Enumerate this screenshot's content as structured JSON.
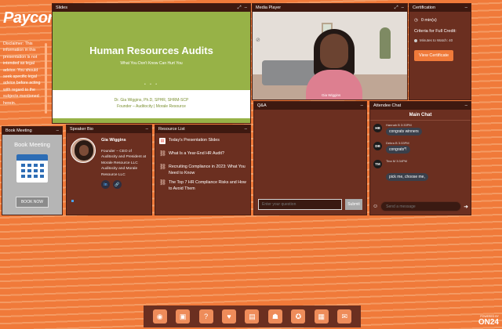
{
  "logo": {
    "text": "Paycor"
  },
  "disclaimer": {
    "text": "Disclaimer: This information in this presentation is not intended as legal advice. You should seek specific legal advice before acting with regard to the subjects mentioned herein."
  },
  "slides": {
    "header": "Slides",
    "title": "Human Resources Audits",
    "subtitle": "What You Don't Know Can Hurt You",
    "presenter_line1": "Dr. Gia Wiggins, Ph.D, SPHR, SHRM-SCP",
    "presenter_line2": "Founder – Auditocity | Morale Resource"
  },
  "media": {
    "header": "Media Player",
    "person_label": "Gia Wiggins"
  },
  "certification": {
    "header": "Certification",
    "time": "0 min(s)",
    "criteria": "Criteria for Full Credit:",
    "minutes": "Minutes to Watch: 40",
    "button": "View Certificate"
  },
  "book": {
    "header": "Book Meeting",
    "title": "Book Meeting",
    "button": "BOOK NOW"
  },
  "speaker": {
    "header": "Speaker Bio",
    "name": "Gia Wiggins",
    "role": "Founder – CEO of Auditocity and President at Morale Resource LLC Auditocity and Morale Resource LLC",
    "linkedin": "in"
  },
  "resources": {
    "header": "Resource List",
    "items": [
      {
        "label": "Today's Presentation Slides"
      },
      {
        "label": "What Is a Year-End HR Audit?"
      },
      {
        "label": "Recruiting Compliance in 2023: What You Need to Know"
      },
      {
        "label": "The Top 7 HR Compliance Risks and How to Avoid Them"
      }
    ]
  },
  "qa": {
    "header": "Q&A",
    "placeholder": "Enter your question",
    "submit": "Submit"
  },
  "chat": {
    "header": "Attendee Chat",
    "tab": "Main Chat",
    "messages": [
      {
        "initials": "HB",
        "meta": "Hannah B 3:33PM",
        "text": "congrats winners"
      },
      {
        "initials": "DB",
        "meta": "Debra B 3:33PM",
        "text": "congrats*!"
      },
      {
        "initials": "TM",
        "meta": "Tina M 3:34PM",
        "text": "pick me, choose me,"
      }
    ],
    "placeholder": "Send a message"
  },
  "brand": {
    "powered": "POWERED BY",
    "name": "ON24"
  },
  "colors": {
    "accent": "#f07a3a",
    "panel": "#6b2f20",
    "slide_green": "#97b247"
  }
}
